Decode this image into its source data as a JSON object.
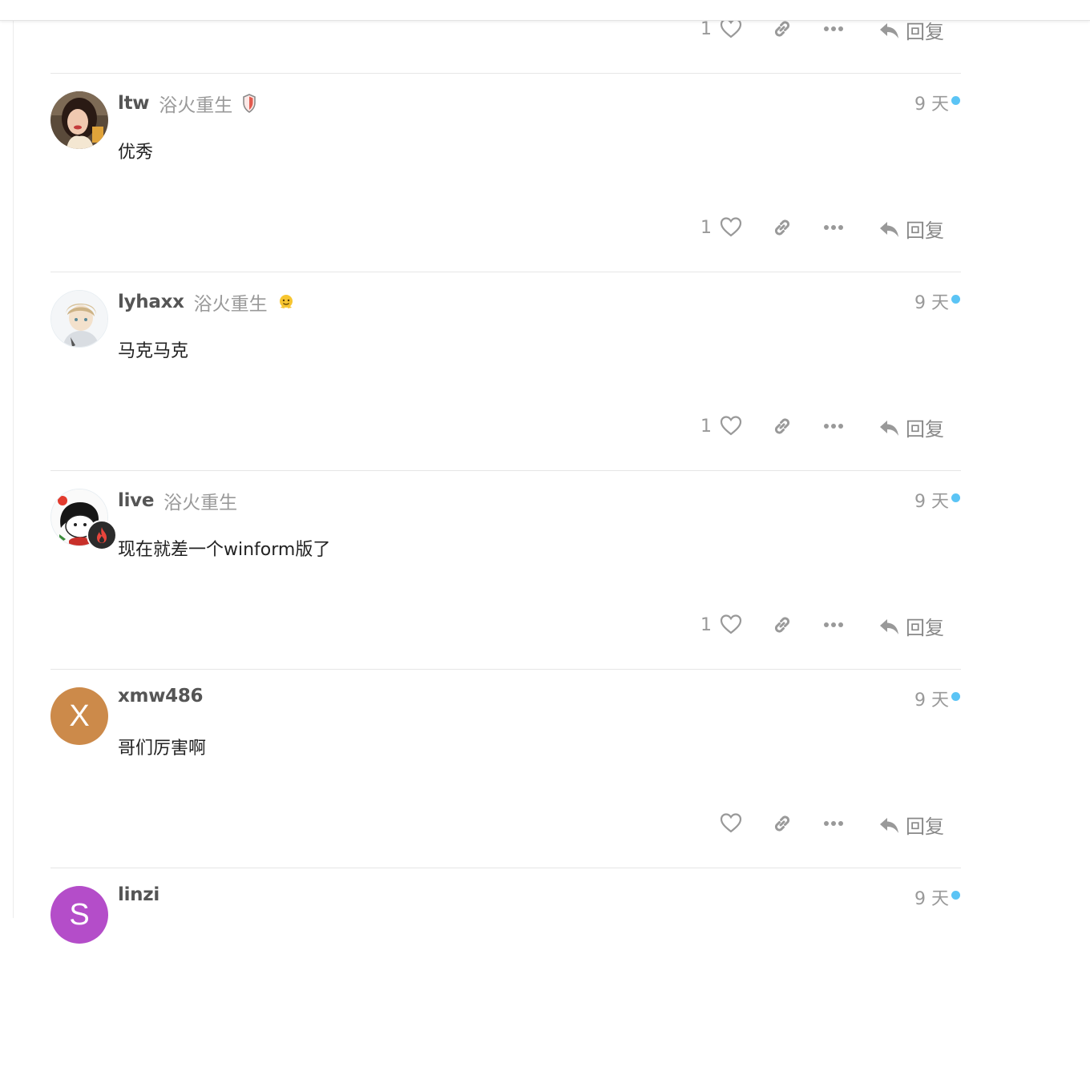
{
  "reply_label": "回复",
  "colors": {
    "unread_dot": "#5bc4f5",
    "muted_text": "#999999",
    "username": "#555555",
    "avatar_xmw486": "#cc8a4a",
    "avatar_linzi": "#b44dc9",
    "flair_bg": "#2b2b2b",
    "flair_fire": "#e8453c"
  },
  "top_partial_post": {
    "like_count": "1",
    "reply_label": "回复"
  },
  "posts": [
    {
      "username": "ltw",
      "user_title": "浴火重生",
      "badge_icon": "shield-badge-icon",
      "date": "9 天",
      "body": "优秀",
      "like_count": "1",
      "reply_label": "回复"
    },
    {
      "username": "lyhaxx",
      "user_title": "浴火重生",
      "badge_icon": "smiley-badge-icon",
      "date": "9 天",
      "body": "马克马克",
      "like_count": "1",
      "reply_label": "回复"
    },
    {
      "username": "live",
      "user_title": "浴火重生",
      "flair_icon": "fire-flair-icon",
      "date": "9 天",
      "body": "现在就差一个winform版了",
      "like_count": "1",
      "reply_label": "回复"
    },
    {
      "username": "xmw486",
      "avatar_letter": "X",
      "date": "9 天",
      "body": "哥们厉害啊",
      "like_count": "",
      "reply_label": "回复"
    },
    {
      "username": "linzi",
      "avatar_letter": "S",
      "date": "9 天"
    }
  ]
}
